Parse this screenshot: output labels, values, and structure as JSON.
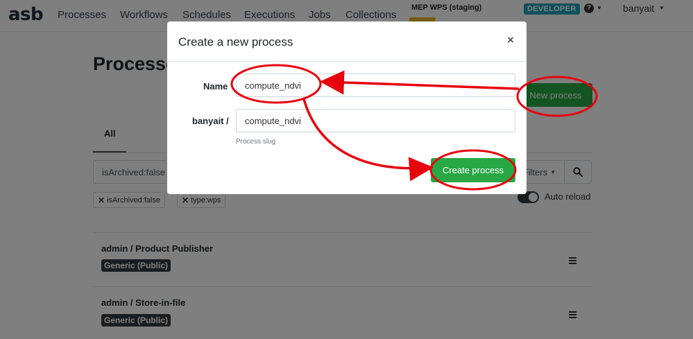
{
  "navbar": {
    "brand": "asb",
    "links": [
      "Processes",
      "Workflows",
      "Schedules",
      "Executions",
      "Jobs",
      "Collections"
    ],
    "environment": "MEP WPS (staging)",
    "badge": "DEVELOPER",
    "help_icon": "question-circle-icon",
    "user": "banyait"
  },
  "page": {
    "title": "Processes",
    "new_process_button": "New process",
    "tabs": [
      "All"
    ],
    "search_value": "isArchived:false",
    "filters_button": "Filters",
    "search_icon": "search-icon",
    "chips": [
      "isArchived:false",
      "type:wps"
    ],
    "auto_reload_label": "Auto reload",
    "auto_reload_on": true,
    "processes": [
      {
        "title": "admin / Product Publisher",
        "badge": "Generic (Public)"
      },
      {
        "title": "admin / Store-in-file",
        "badge": "Generic (Public)"
      }
    ]
  },
  "modal": {
    "title": "Create a new process",
    "close": "×",
    "name_label": "Name",
    "name_value": "compute_ndvi",
    "slug_label": "banyait /",
    "slug_value": "compute_ndvi",
    "slug_help": "Process slug",
    "create_button": "Create process"
  },
  "colors": {
    "success": "#28a745",
    "info": "#17a2b8",
    "badge_dark": "#343a40",
    "annotation": "#e8000d",
    "env_accent": "#e8b923"
  }
}
